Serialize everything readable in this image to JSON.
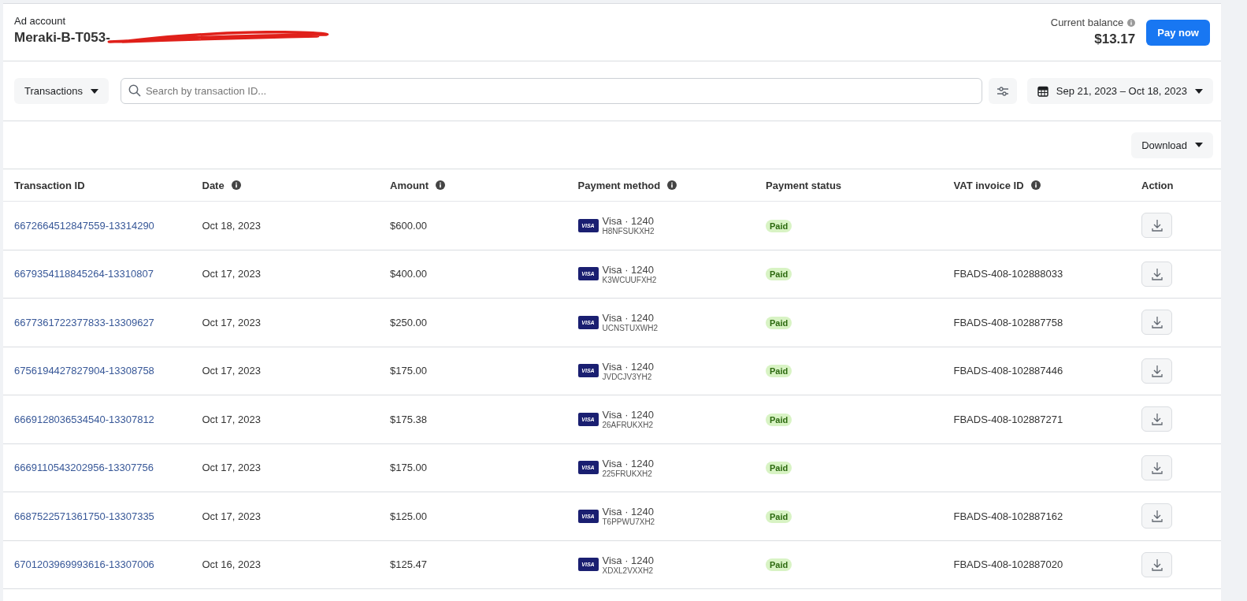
{
  "account": {
    "label": "Ad account",
    "name": "Meraki-B-T053-",
    "redacted": true
  },
  "balance": {
    "label": "Current balance",
    "amount": "$13.17"
  },
  "pay_button": "Pay now",
  "toolbar": {
    "view_dropdown": "Transactions",
    "search": {
      "placeholder": "Search by transaction ID..."
    },
    "date_range": "Sep 21, 2023 – Oct 18, 2023"
  },
  "download_button": "Download",
  "table": {
    "columns": [
      {
        "label": "Transaction ID",
        "info": false
      },
      {
        "label": "Date",
        "info": true
      },
      {
        "label": "Amount",
        "info": true
      },
      {
        "label": "Payment method",
        "info": true
      },
      {
        "label": "Payment status",
        "info": false
      },
      {
        "label": "VAT invoice ID",
        "info": true
      },
      {
        "label": "Action",
        "info": false
      }
    ],
    "rows": [
      {
        "id": "6672664512847559-13314290",
        "date": "Oct 18, 2023",
        "amount": "$600.00",
        "card_badge": "VISA",
        "method": "Visa · 1240",
        "ref": "H8NFSUKXH2",
        "status": "Paid",
        "vat": ""
      },
      {
        "id": "6679354118845264-13310807",
        "date": "Oct 17, 2023",
        "amount": "$400.00",
        "card_badge": "VISA",
        "method": "Visa · 1240",
        "ref": "K3WCUUFXH2",
        "status": "Paid",
        "vat": "FBADS-408-102888033"
      },
      {
        "id": "6677361722377833-13309627",
        "date": "Oct 17, 2023",
        "amount": "$250.00",
        "card_badge": "VISA",
        "method": "Visa · 1240",
        "ref": "UCNSTUXWH2",
        "status": "Paid",
        "vat": "FBADS-408-102887758"
      },
      {
        "id": "6756194427827904-13308758",
        "date": "Oct 17, 2023",
        "amount": "$175.00",
        "card_badge": "VISA",
        "method": "Visa · 1240",
        "ref": "JVDCJV3YH2",
        "status": "Paid",
        "vat": "FBADS-408-102887446"
      },
      {
        "id": "6669128036534540-13307812",
        "date": "Oct 17, 2023",
        "amount": "$175.38",
        "card_badge": "VISA",
        "method": "Visa · 1240",
        "ref": "26AFRUKXH2",
        "status": "Paid",
        "vat": "FBADS-408-102887271"
      },
      {
        "id": "6669110543202956-13307756",
        "date": "Oct 17, 2023",
        "amount": "$175.00",
        "card_badge": "VISA",
        "method": "Visa · 1240",
        "ref": "225FRUKXH2",
        "status": "Paid",
        "vat": ""
      },
      {
        "id": "6687522571361750-13307335",
        "date": "Oct 17, 2023",
        "amount": "$125.00",
        "card_badge": "VISA",
        "method": "Visa · 1240",
        "ref": "T6PPWU7XH2",
        "status": "Paid",
        "vat": "FBADS-408-102887162"
      },
      {
        "id": "6701203969993616-13307006",
        "date": "Oct 16, 2023",
        "amount": "$125.47",
        "card_badge": "VISA",
        "method": "Visa · 1240",
        "ref": "XDXL2VXXH2",
        "status": "Paid",
        "vat": "FBADS-408-102887020"
      }
    ]
  }
}
